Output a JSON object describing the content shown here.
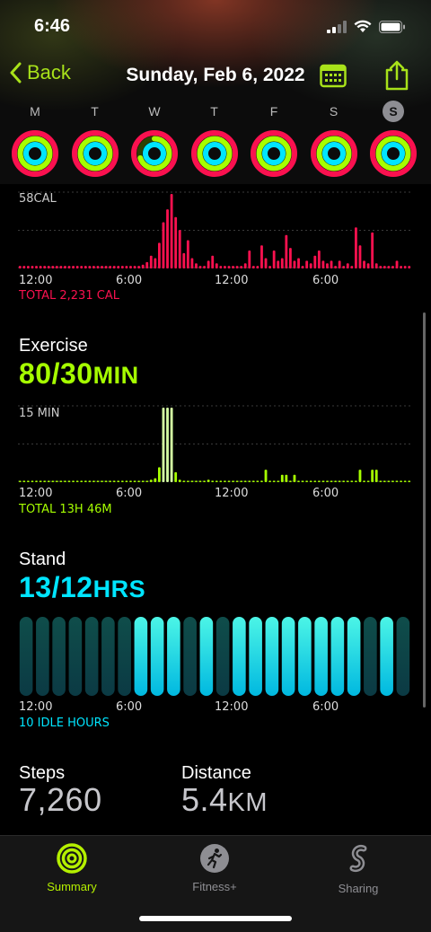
{
  "status": {
    "time": "6:46"
  },
  "nav": {
    "back_label": "Back",
    "title": "Sunday, Feb 6, 2022"
  },
  "week": {
    "days": [
      {
        "letter": "M",
        "selected": false
      },
      {
        "letter": "T",
        "selected": false
      },
      {
        "letter": "W",
        "selected": false
      },
      {
        "letter": "T",
        "selected": false
      },
      {
        "letter": "F",
        "selected": false
      },
      {
        "letter": "S",
        "selected": false
      },
      {
        "letter": "S",
        "selected": true
      }
    ],
    "move_progress": [
      1,
      1,
      1,
      1,
      1,
      1,
      1
    ],
    "exercise_progress": [
      1,
      1,
      0.7,
      1,
      1,
      1,
      1
    ],
    "stand_progress": [
      1,
      1,
      1,
      1,
      1,
      1,
      1
    ]
  },
  "move": {
    "scale_label": "58CAL",
    "total": "TOTAL 2,231 CAL",
    "color": "#fa114f"
  },
  "exercise": {
    "title": "Exercise",
    "value": "80/30",
    "unit": "MIN",
    "scale_label": "15 MIN",
    "total": "TOTAL 13H 46M",
    "color": "#a6ff00"
  },
  "stand": {
    "title": "Stand",
    "value": "13/12",
    "unit": "HRS",
    "total": "10 IDLE HOURS",
    "color": "#00e5ff"
  },
  "axis": [
    "12:00",
    "6:00",
    "12:00",
    "6:00"
  ],
  "steps": {
    "title": "Steps",
    "value": "7,260"
  },
  "distance": {
    "title": "Distance",
    "value": "5.4",
    "unit": "KM"
  },
  "tabs": [
    {
      "label": "Summary",
      "active": true
    },
    {
      "label": "Fitness+",
      "active": false
    },
    {
      "label": "Sharing",
      "active": false
    }
  ],
  "chart_data": [
    {
      "type": "bar",
      "title": "",
      "scale_label": "58CAL",
      "note": "TOTAL 2,231 CAL",
      "x": [
        0,
        1,
        2,
        3,
        4,
        5,
        6,
        7,
        8,
        9,
        10,
        11,
        12,
        13,
        14,
        15,
        16,
        17,
        18,
        19,
        20,
        21,
        22,
        23,
        24,
        25,
        26,
        27,
        28,
        29,
        30,
        31,
        32,
        33,
        34,
        35,
        36,
        37,
        38,
        39,
        40,
        41,
        42,
        43,
        44,
        45,
        46,
        47,
        48,
        49,
        50,
        51,
        52,
        53,
        54,
        55,
        56,
        57,
        58,
        59,
        60,
        61,
        62,
        63,
        64,
        65,
        66,
        67,
        68,
        69,
        70,
        71,
        72,
        73,
        74,
        75,
        76,
        77,
        78,
        79,
        80,
        81,
        82,
        83,
        84,
        85,
        86,
        87,
        88,
        89,
        90,
        91,
        92,
        93,
        94,
        95
      ],
      "values": [
        2,
        2,
        2,
        2,
        2,
        2,
        2,
        2,
        2,
        2,
        2,
        2,
        2,
        2,
        2,
        2,
        2,
        2,
        2,
        2,
        2,
        2,
        2,
        2,
        2,
        2,
        2,
        2,
        2,
        2,
        3,
        5,
        10,
        8,
        20,
        36,
        46,
        58,
        40,
        30,
        12,
        22,
        8,
        4,
        2,
        2,
        6,
        10,
        4,
        2,
        2,
        2,
        2,
        2,
        2,
        4,
        14,
        2,
        2,
        18,
        8,
        2,
        14,
        6,
        8,
        26,
        16,
        6,
        8,
        2,
        6,
        4,
        10,
        14,
        6,
        4,
        6,
        2,
        6,
        2,
        4,
        2,
        32,
        18,
        6,
        4,
        28,
        4,
        2,
        2,
        2,
        2,
        6,
        2,
        2,
        2
      ],
      "ylim": [
        0,
        58
      ],
      "xticks": [
        "12:00",
        "6:00",
        "12:00",
        "6:00"
      ],
      "color": "#fa114f"
    },
    {
      "type": "bar",
      "title": "",
      "scale_label": "15 MIN",
      "note": "TOTAL 13H 46M",
      "x": [
        0,
        1,
        2,
        3,
        4,
        5,
        6,
        7,
        8,
        9,
        10,
        11,
        12,
        13,
        14,
        15,
        16,
        17,
        18,
        19,
        20,
        21,
        22,
        23,
        24,
        25,
        26,
        27,
        28,
        29,
        30,
        31,
        32,
        33,
        34,
        35,
        36,
        37,
        38,
        39,
        40,
        41,
        42,
        43,
        44,
        45,
        46,
        47,
        48,
        49,
        50,
        51,
        52,
        53,
        54,
        55,
        56,
        57,
        58,
        59,
        60,
        61,
        62,
        63,
        64,
        65,
        66,
        67,
        68,
        69,
        70,
        71,
        72,
        73,
        74,
        75,
        76,
        77,
        78,
        79,
        80,
        81,
        82,
        83,
        84,
        85,
        86,
        87,
        88,
        89,
        90,
        91,
        92,
        93,
        94,
        95
      ],
      "values": [
        0.3,
        0.3,
        0.3,
        0.3,
        0.3,
        0.3,
        0.3,
        0.3,
        0.3,
        0.3,
        0.3,
        0.3,
        0.3,
        0.3,
        0.3,
        0.3,
        0.3,
        0.3,
        0.3,
        0.3,
        0.3,
        0.3,
        0.3,
        0.3,
        0.3,
        0.3,
        0.3,
        0.3,
        0.3,
        0.3,
        0.3,
        0.3,
        0.5,
        0.8,
        3,
        15,
        15,
        15,
        2,
        0.5,
        0.3,
        0.3,
        0.3,
        0.3,
        0.3,
        0.3,
        0.5,
        0.3,
        0.3,
        0.3,
        0.3,
        0.3,
        0.3,
        0.3,
        0.3,
        0.3,
        0.3,
        0.3,
        0.3,
        0.3,
        2.5,
        0.3,
        0.3,
        0.3,
        1.5,
        1.5,
        0.3,
        1.5,
        0.3,
        0.3,
        0.3,
        0.3,
        0.3,
        0.3,
        0.3,
        0.3,
        0.3,
        0.3,
        0.3,
        0.3,
        0.3,
        0.3,
        0.3,
        2.5,
        0.3,
        0.3,
        2.5,
        2.5,
        0.3,
        0.3,
        0.3,
        0.3,
        0.3,
        0.3,
        0.3,
        0.3
      ],
      "ylim": [
        0,
        15
      ],
      "xticks": [
        "12:00",
        "6:00",
        "12:00",
        "6:00"
      ],
      "color": "#a6ff00"
    },
    {
      "type": "bar",
      "title": "",
      "note": "10 IDLE HOURS",
      "x": [
        0,
        1,
        2,
        3,
        4,
        5,
        6,
        7,
        8,
        9,
        10,
        11,
        12,
        13,
        14,
        15,
        16,
        17,
        18,
        19,
        20,
        21,
        22,
        23
      ],
      "values": [
        0,
        0,
        0,
        0,
        0,
        0,
        0,
        1,
        1,
        1,
        0,
        1,
        0,
        1,
        1,
        1,
        1,
        1,
        1,
        1,
        1,
        0,
        1,
        0
      ],
      "ylim": [
        0,
        1
      ],
      "xticks": [
        "12:00",
        "6:00",
        "12:00",
        "6:00"
      ],
      "color": "#00e5ff"
    }
  ]
}
